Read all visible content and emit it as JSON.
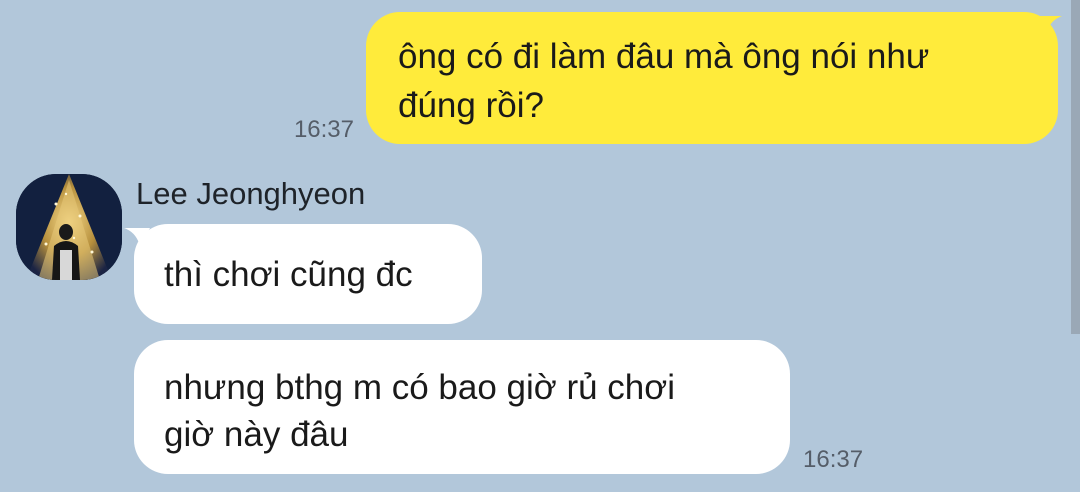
{
  "messages": {
    "outgoing": {
      "text_line1": "ông có đi làm đâu mà ông nói như",
      "text_line2": "đúng rồi?",
      "time": "16:37"
    },
    "incoming": {
      "sender": "Lee Jeonghyeon",
      "first": "thì chơi cũng đc",
      "second_line1": "nhưng bthg m có bao giờ rủ chơi",
      "second_line2": "giờ này đâu",
      "time": "16:37"
    }
  },
  "colors": {
    "background": "#b2c7da",
    "outgoing_bubble": "#ffeb3b",
    "incoming_bubble": "#ffffff"
  },
  "icons": {
    "avatar": "profile-photo-avatar"
  }
}
